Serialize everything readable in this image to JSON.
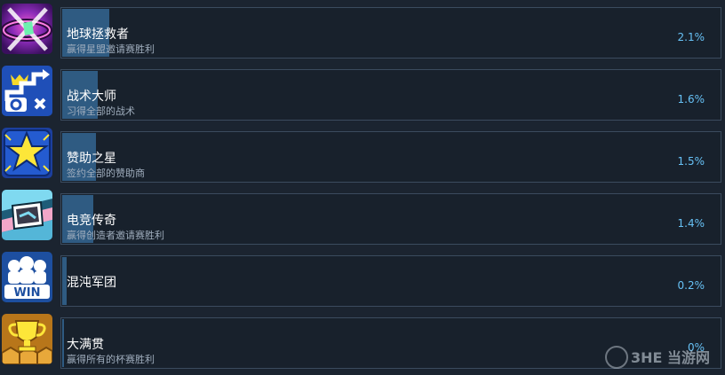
{
  "achievements": [
    {
      "icon": "galaxy-rescue-icon",
      "title": "地球拯救者",
      "description": "赢得星盟邀请赛胜利",
      "percent_label": "2.1%",
      "percent": 2.1
    },
    {
      "icon": "tactics-path-icon",
      "title": "战术大师",
      "description": "习得全部的战术",
      "percent_label": "1.6%",
      "percent": 1.6
    },
    {
      "icon": "sponsor-star-icon",
      "title": "赞助之星",
      "description": "签约全部的赞助商",
      "percent_label": "1.5%",
      "percent": 1.5
    },
    {
      "icon": "esports-legend-icon",
      "title": "电竞传奇",
      "description": "赢得创造者邀请赛胜利",
      "percent_label": "1.4%",
      "percent": 1.4
    },
    {
      "icon": "team-win-icon",
      "title": "混沌军团",
      "description": "",
      "percent_label": "0.2%",
      "percent": 0.2
    },
    {
      "icon": "trophy-icon",
      "title": "大满贯",
      "description": "赢得所有的杯赛胜利",
      "percent_label": "0%",
      "percent": 0
    }
  ],
  "watermark": {
    "text": "3HE 当游网"
  }
}
